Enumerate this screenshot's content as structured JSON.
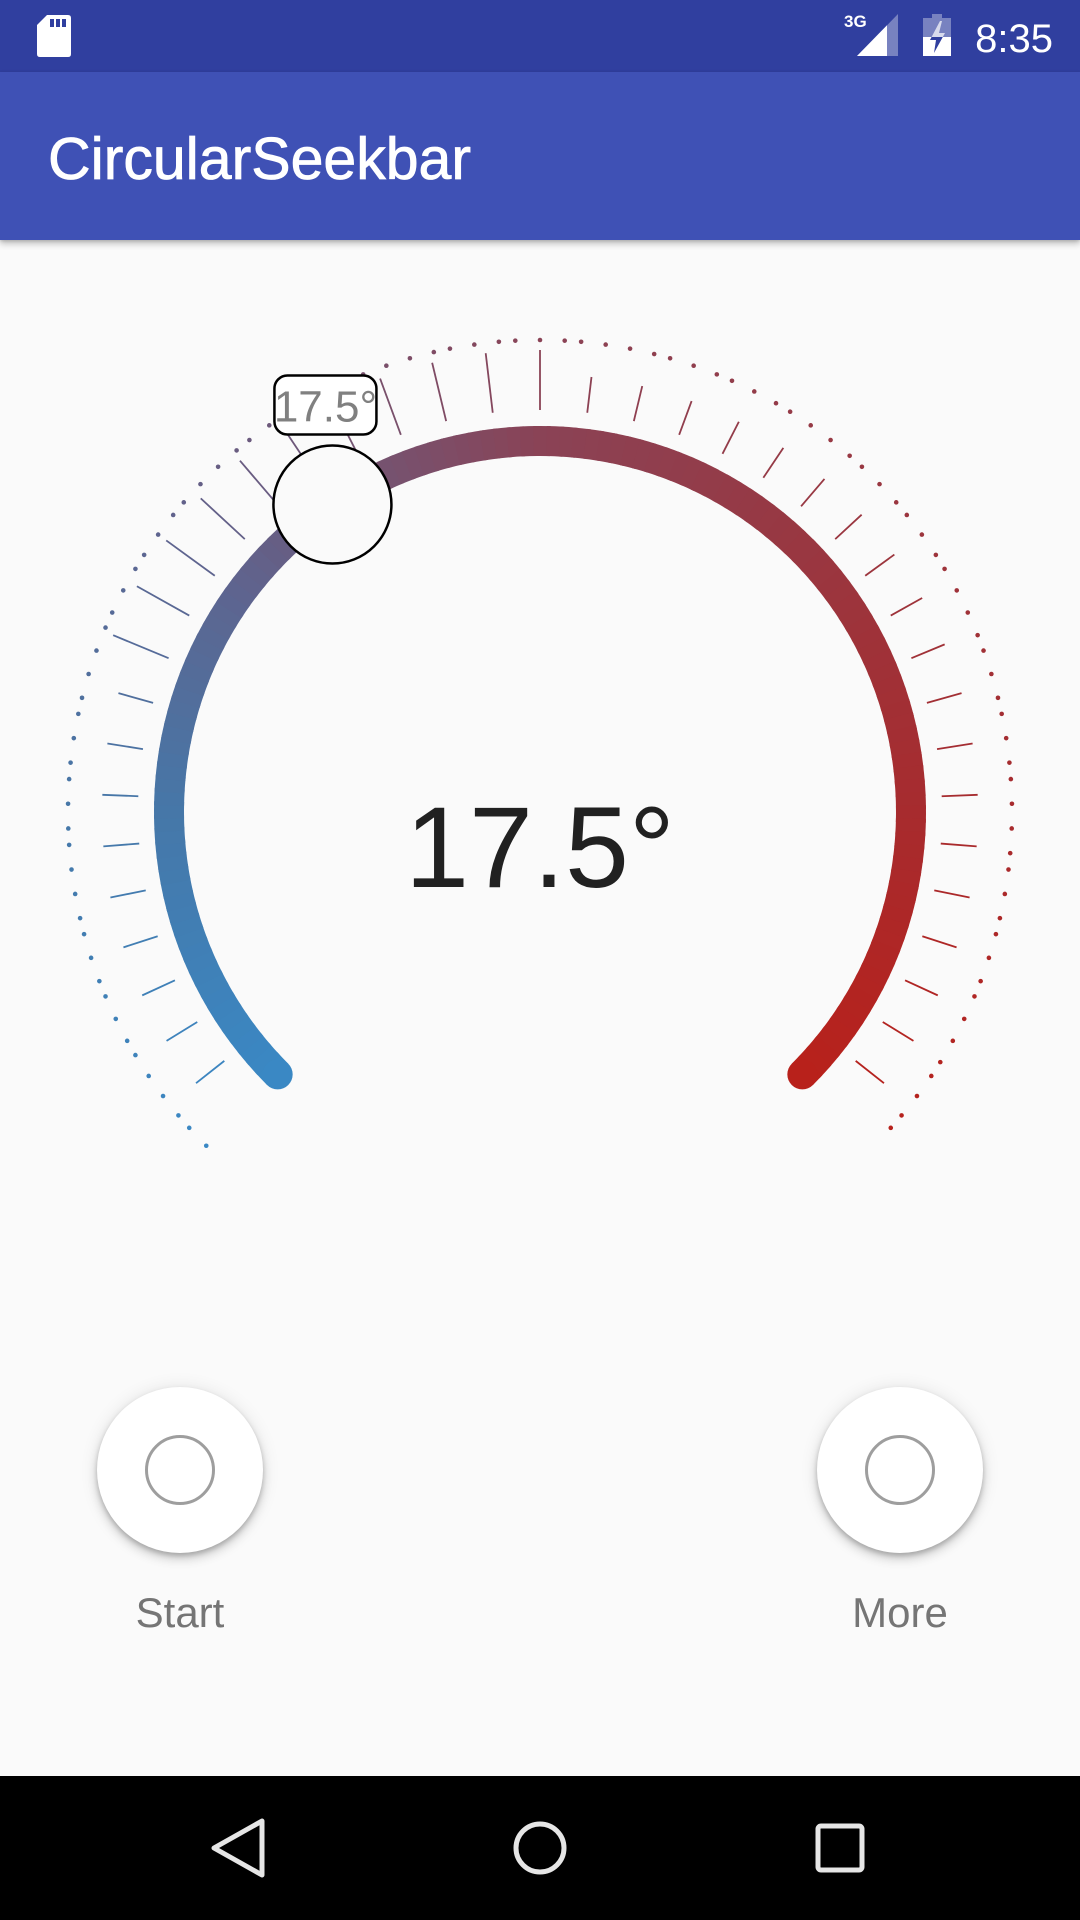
{
  "status_bar": {
    "time": "8:35",
    "network_type": "3G",
    "icons": {
      "storage": "sd-card-icon",
      "signal": "signal-icon",
      "battery": "battery-charging-icon"
    }
  },
  "app_bar": {
    "title": "CircularSeekbar"
  },
  "seekbar": {
    "value_text": "17.5°",
    "tooltip_text": "17.5°",
    "progress_fraction": 0.374,
    "tick_count": 39,
    "dot_count": 100,
    "track_gradient": [
      {
        "at": 0.0,
        "color": "#3a88c4"
      },
      {
        "at": 0.167,
        "color": "#4677a8"
      },
      {
        "at": 0.296,
        "color": "#5d6590"
      },
      {
        "at": 0.5,
        "color": "#8a4356"
      },
      {
        "at": 0.722,
        "color": "#9e333a"
      },
      {
        "at": 0.833,
        "color": "#a72b2e"
      },
      {
        "at": 1.0,
        "color": "#b8211b"
      }
    ]
  },
  "actions": [
    {
      "label": "Start",
      "icon": "circle-outline-icon"
    },
    {
      "label": "More",
      "icon": "circle-outline-icon"
    }
  ],
  "nav_bar": {
    "buttons": [
      "back",
      "home",
      "recents"
    ]
  },
  "colors": {
    "status_bar": "#303f9f",
    "app_bar": "#3f51b5",
    "background": "#fafafa",
    "value_text": "#212121",
    "label_text": "#757575",
    "tooltip_text": "#808080"
  }
}
